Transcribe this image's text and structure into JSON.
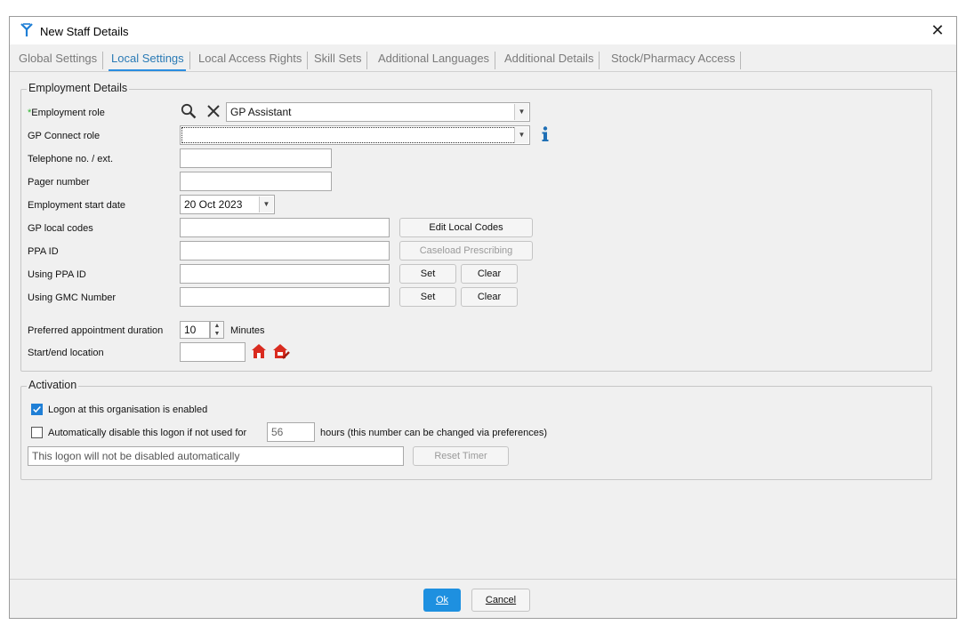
{
  "window": {
    "title": "New Staff Details",
    "close_glyph": "✕"
  },
  "tabs": [
    {
      "label": "Global Settings"
    },
    {
      "label": "Local Settings"
    },
    {
      "label": "Local Access Rights"
    },
    {
      "label": "Skill Sets"
    },
    {
      "label": "Additional Languages"
    },
    {
      "label": "Additional Details"
    },
    {
      "label": "Stock/Pharmacy Access"
    }
  ],
  "active_tab": "Local Settings",
  "employment": {
    "legend": "Employment Details",
    "role_required_marker": "*",
    "role_label": "Employment role",
    "role_value": "GP Assistant",
    "gp_connect_label": "GP Connect role",
    "gp_connect_value": "",
    "telephone_label": "Telephone no. / ext.",
    "telephone_value": "",
    "pager_label": "Pager number",
    "pager_value": "",
    "start_date_label": "Employment start date",
    "start_date_value": "20 Oct 2023",
    "gp_local_codes_label": "GP local codes",
    "gp_local_codes_value": "",
    "edit_local_codes_button": "Edit Local Codes",
    "ppa_id_label": "PPA ID",
    "ppa_id_value": "",
    "caseload_button": "Caseload Prescribing",
    "using_ppa_label": "Using PPA ID",
    "using_ppa_value": "",
    "using_gmc_label": "Using GMC Number",
    "using_gmc_value": "",
    "set_button": "Set",
    "clear_button": "Clear",
    "appt_duration_label": "Preferred appointment duration",
    "appt_duration_value": "10",
    "appt_duration_unit": "Minutes",
    "location_label": "Start/end location",
    "location_value": ""
  },
  "activation": {
    "legend": "Activation",
    "logon_enabled_label": "Logon at this organisation is enabled",
    "logon_enabled_checked": true,
    "auto_disable_label": "Automatically disable this logon if not used for",
    "auto_disable_checked": false,
    "auto_disable_hours": "56",
    "auto_disable_suffix": "hours (this number can be changed via preferences)",
    "status_text": "This logon will not be disabled automatically",
    "reset_timer_button": "Reset Timer"
  },
  "footer": {
    "ok_label": "Ok",
    "cancel_label": "Cancel"
  },
  "colors": {
    "accent": "#1e90e0",
    "required": "#2bb52b",
    "location_icon": "#d92b1f",
    "info_icon": "#1f6fb5"
  }
}
